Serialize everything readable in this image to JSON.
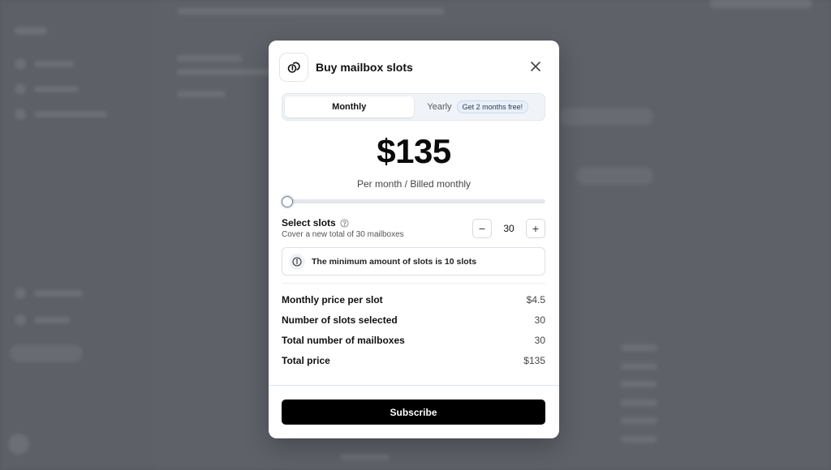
{
  "modal": {
    "title": "Buy mailbox slots",
    "icon": "coins-icon",
    "close_icon": "close-icon"
  },
  "billing": {
    "monthly_label": "Monthly",
    "yearly_label": "Yearly",
    "yearly_badge": "Get 2 months free!",
    "selected": "Monthly"
  },
  "price": {
    "amount": "$135",
    "subtitle": "Per month / Billed monthly"
  },
  "slider": {
    "value_fraction": 0.0
  },
  "slots": {
    "label": "Select slots",
    "help_icon": "question-circle-icon",
    "subtitle": "Cover a new total of 30 mailboxes",
    "value": "30",
    "decrement_label": "−",
    "increment_label": "+"
  },
  "info": {
    "icon": "info-icon",
    "text": "The minimum amount of slots is 10 slots"
  },
  "summary": [
    {
      "label": "Monthly price per slot",
      "value": "$4.5"
    },
    {
      "label": "Number of slots selected",
      "value": "30"
    },
    {
      "label": "Total number of mailboxes",
      "value": "30"
    },
    {
      "label": "Total price",
      "value": "$135"
    }
  ],
  "subscribe_label": "Subscribe",
  "colors": {
    "primary_button": "#000000",
    "backdrop": "#5f6269",
    "toggle_bg": "#f0f3f7"
  }
}
